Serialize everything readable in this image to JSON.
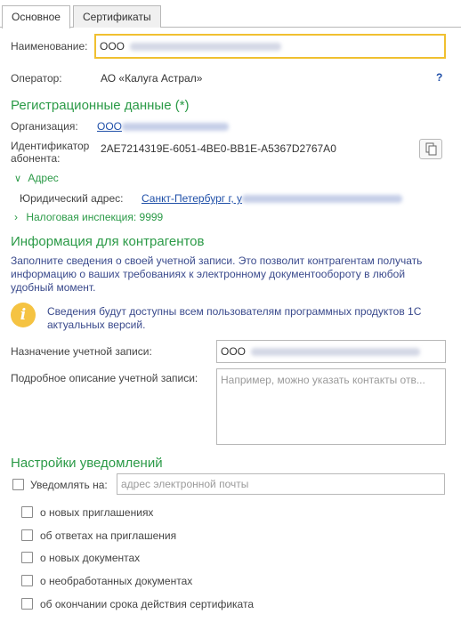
{
  "tabs": [
    {
      "label": "Основное",
      "active": true
    },
    {
      "label": "Сертификаты",
      "active": false
    }
  ],
  "name_field": {
    "label": "Наименование:",
    "value": "ООО"
  },
  "operator": {
    "label": "Оператор:",
    "value": "АО «Калуга Астрал»",
    "help": "?"
  },
  "registration": {
    "title": "Регистрационные данные (*)",
    "org_label": "Организация:",
    "org_value": "ООО",
    "subscriber_label_1": "Идентификатор",
    "subscriber_label_2": "абонента:",
    "subscriber_id": "2AE7214319E-6051-4BE0-BB1E-A5367D2767A0",
    "address_toggle": "Адрес",
    "legal_address_label": "Юридический адрес:",
    "legal_address_value": "Санкт-Петербург г, у",
    "tax_label": "Налоговая инспекция: 9999"
  },
  "contractors": {
    "title": "Информация для контрагентов",
    "description": "Заполните сведения о своей учетной записи. Это позволит контрагентам получать информацию о ваших требованиях к электронному документообороту в любой удобный момент.",
    "info_icon": "i",
    "info_text": "Сведения будут доступны всем пользователям программных продуктов 1С актуальных версий.",
    "purpose_label": "Назначение учетной записи:",
    "purpose_value": "ООО",
    "detail_label": "Подробное описание учетной записи:",
    "detail_placeholder": "Например, можно указать контакты отв..."
  },
  "notifications": {
    "title": "Настройки уведомлений",
    "notify_label": "Уведомлять на:",
    "email_placeholder": "адрес электронной почты",
    "options": [
      {
        "label": "о новых приглашениях",
        "checked": false
      },
      {
        "label": "об ответах на приглашения",
        "checked": false
      },
      {
        "label": "о новых документах",
        "checked": false
      },
      {
        "label": "о необработанных документах",
        "checked": false
      },
      {
        "label": "об окончании срока действия сертификата",
        "checked": false
      }
    ]
  },
  "colors": {
    "section_heading": "#2b9a47",
    "link": "#1f4fa8",
    "info_text": "#3a4a8c",
    "focus_border": "#f0c030",
    "info_icon_bg": "#f5c342"
  }
}
